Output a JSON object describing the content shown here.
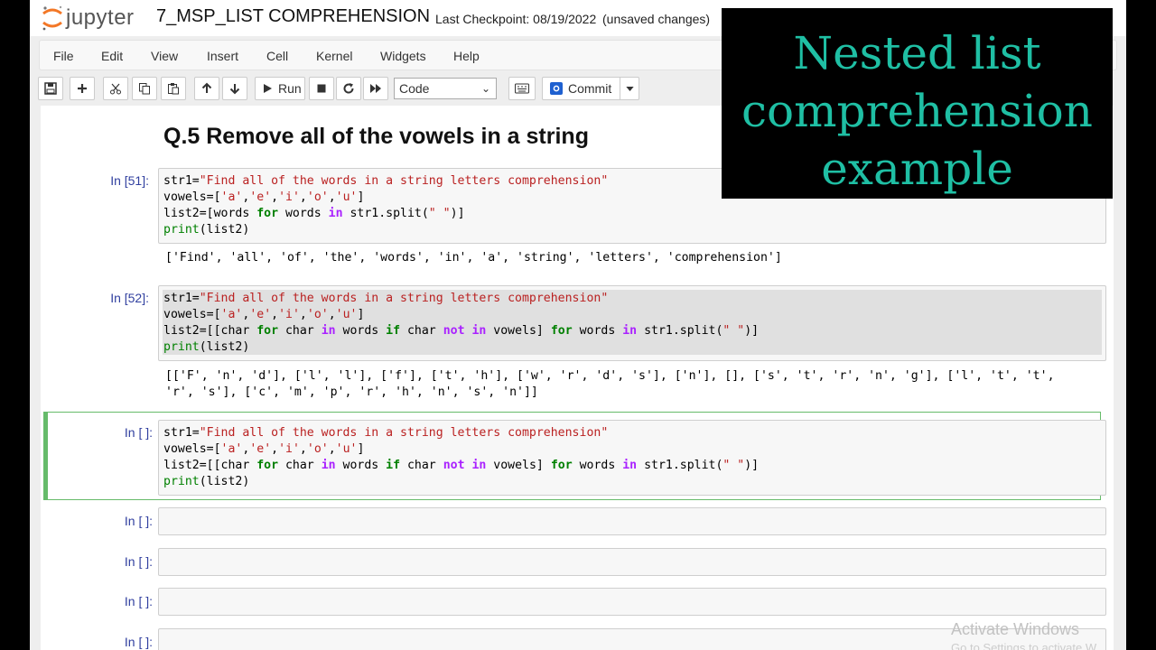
{
  "header": {
    "logo_text": "jupyter",
    "notebook_name": "7_MSP_LIST COMPREHENSION",
    "checkpoint": "Last Checkpoint: 08/19/2022",
    "status": "(unsaved changes)"
  },
  "menu": {
    "items": [
      "File",
      "Edit",
      "View",
      "Insert",
      "Cell",
      "Kernel",
      "Widgets",
      "Help"
    ]
  },
  "toolbar": {
    "run_label": "Run",
    "cell_type": "Code",
    "commit_label": "Commit",
    "icons": [
      "save-icon",
      "plus-icon",
      "cut-icon",
      "copy-icon",
      "paste-icon",
      "arrow-up-icon",
      "arrow-down-icon",
      "play-icon",
      "stop-icon",
      "restart-icon",
      "fast-forward-icon",
      "keyboard-icon",
      "commit-icon",
      "caret-down-icon"
    ]
  },
  "notebook": {
    "heading": "Q.5 Remove all of the vowels in a string",
    "cells": [
      {
        "prompt": "In [51]:",
        "lines": [
          "str1=\"Find all of the words in a string letters comprehension\"",
          "vowels=['a','e','i','o','u']",
          "list2=[words for words in str1.split(\" \")]",
          "print(list2)"
        ],
        "output": [
          "['Find', 'all', 'of', 'the', 'words', 'in', 'a', 'string', 'letters', 'comprehension']"
        ]
      },
      {
        "prompt": "In [52]:",
        "lines": [
          "str1=\"Find all of the words in a string letters comprehension\"",
          "vowels=['a','e','i','o','u']",
          "list2=[[char for char in words if char not in vowels] for words in str1.split(\" \")]",
          "print(list2)"
        ],
        "output": [
          "[['F', 'n', 'd'], ['l', 'l'], ['f'], ['t', 'h'], ['w', 'r', 'd', 's'], ['n'], [], ['s', 't', 'r', 'n', 'g'], ['l', 't', 't',",
          "'r', 's'], ['c', 'm', 'p', 'r', 'h', 'n', 's', 'n']]"
        ]
      },
      {
        "prompt": "In [ ]:",
        "lines": [
          "str1=\"Find all of the words in a string letters comprehension\"",
          "vowels=['a','e','i','o','u']",
          "list2=[[char for char in words if char not in vowels] for words in str1.split(\" \")]",
          "print(list2)"
        ]
      },
      {
        "prompt": "In [ ]:"
      },
      {
        "prompt": "In [ ]:"
      },
      {
        "prompt": "In [ ]:"
      },
      {
        "prompt": "In [ ]:"
      }
    ]
  },
  "overlay": {
    "lines": [
      "Nested list",
      "comprehension",
      "example"
    ]
  },
  "watermark": {
    "line1": "Activate Windows",
    "line2": "Go to Settings to activate W"
  },
  "colors": {
    "overlay_text": "#1fbfa4",
    "selected_border": "#66bb6a",
    "prompt": "#303f9f",
    "keyword": "#008000",
    "string": "#ba2121"
  }
}
